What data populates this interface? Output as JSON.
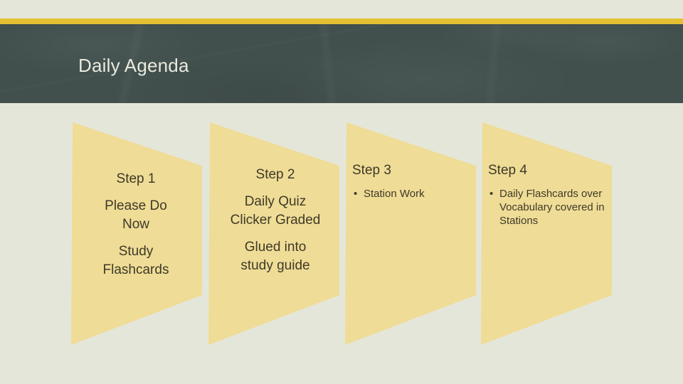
{
  "slide": {
    "title": "Daily Agenda",
    "background_color": "#E5E6DA",
    "accent_bar_color": "#E3C133",
    "header_color": "#414F4D",
    "title_color": "#E9EADE",
    "chevron_color": "#EFDC96",
    "chevron_text_color": "#3E3A28"
  },
  "steps": [
    {
      "heading": "Step 1",
      "align": "center",
      "lines": [
        "Please Do",
        "Now"
      ],
      "lines2": [
        "Study",
        "Flashcards"
      ],
      "bullets": []
    },
    {
      "heading": "Step 2",
      "align": "center",
      "lines": [
        "Daily Quiz",
        "Clicker Graded"
      ],
      "lines2": [
        "Glued into",
        "study guide"
      ],
      "bullets": []
    },
    {
      "heading": "Step 3",
      "align": "left",
      "lines": [],
      "lines2": [],
      "bullets": [
        "Station Work"
      ]
    },
    {
      "heading": "Step 4",
      "align": "left",
      "lines": [],
      "lines2": [],
      "bullets": [
        "Daily Flashcards over Vocabulary covered in Stations"
      ]
    }
  ],
  "symbols": {
    "bullet": "•"
  }
}
